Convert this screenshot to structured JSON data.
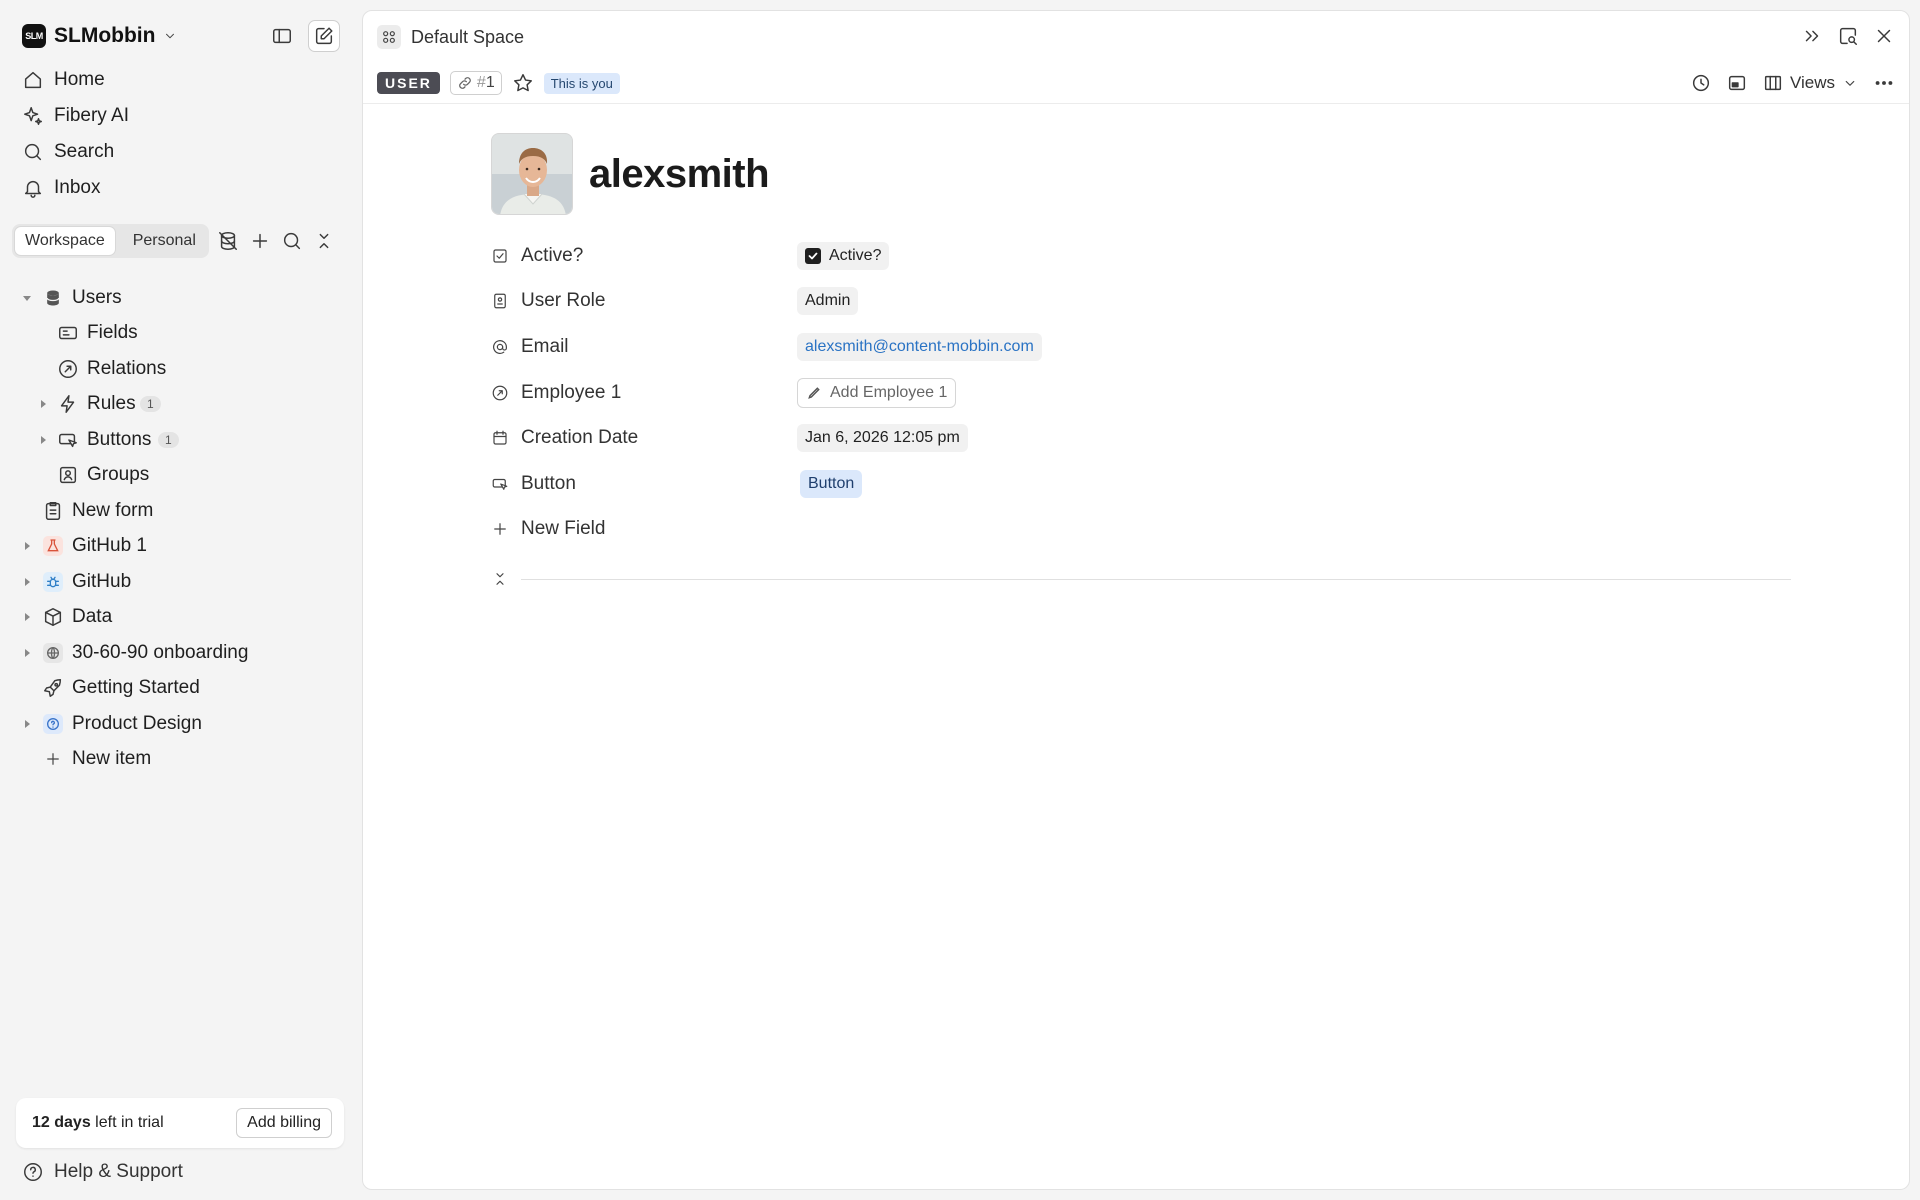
{
  "brand": {
    "logo_text": "SLM",
    "name": "SLMobbin"
  },
  "nav": [
    {
      "label": "Home",
      "icon": "home-icon"
    },
    {
      "label": "Fibery AI",
      "icon": "sparkle-icon"
    },
    {
      "label": "Search",
      "icon": "search-icon"
    },
    {
      "label": "Inbox",
      "icon": "bell-icon"
    }
  ],
  "workspace_tabs": {
    "workspace": "Workspace",
    "personal": "Personal"
  },
  "tree": {
    "users": "Users",
    "fields": "Fields",
    "relations": "Relations",
    "rules": "Rules",
    "rules_count": "1",
    "buttons": "Buttons",
    "buttons_count": "1",
    "groups": "Groups",
    "new_form": "New form",
    "github1": "GitHub 1",
    "github": "GitHub",
    "data": "Data",
    "onboarding": "30-60-90 onboarding",
    "getting_started": "Getting Started",
    "product_design": "Product Design",
    "new_item": "New item"
  },
  "trial": {
    "days": "12 days",
    "suffix": " left in trial",
    "button": "Add billing"
  },
  "help": "Help & Support",
  "main": {
    "breadcrumb": "Default Space",
    "type_badge": "USER",
    "id_hash": "#",
    "id_number": "1",
    "you_badge": "This is you",
    "views_label": "Views",
    "title": "alexsmith"
  },
  "fields": {
    "active_label": "Active?",
    "active_value": "Active?",
    "role_label": "User Role",
    "role_value": "Admin",
    "email_label": "Email",
    "email_value": "alexsmith@content-mobbin.com",
    "employee_label": "Employee 1",
    "employee_value": "Add Employee 1",
    "creation_label": "Creation Date",
    "creation_value": "Jan 6, 2026 12:05 pm",
    "button_label": "Button",
    "button_value": "Button",
    "new_field": "New Field"
  },
  "colors": {
    "accent_link": "#2a73c4",
    "badge_blue_bg": "#dbe8fb",
    "type_badge_bg": "#4c4c54",
    "github1_icon_bg": "#fbe3de",
    "github_icon_bg": "#dfeefb",
    "product_design_icon_bg": "#dde9fb"
  }
}
